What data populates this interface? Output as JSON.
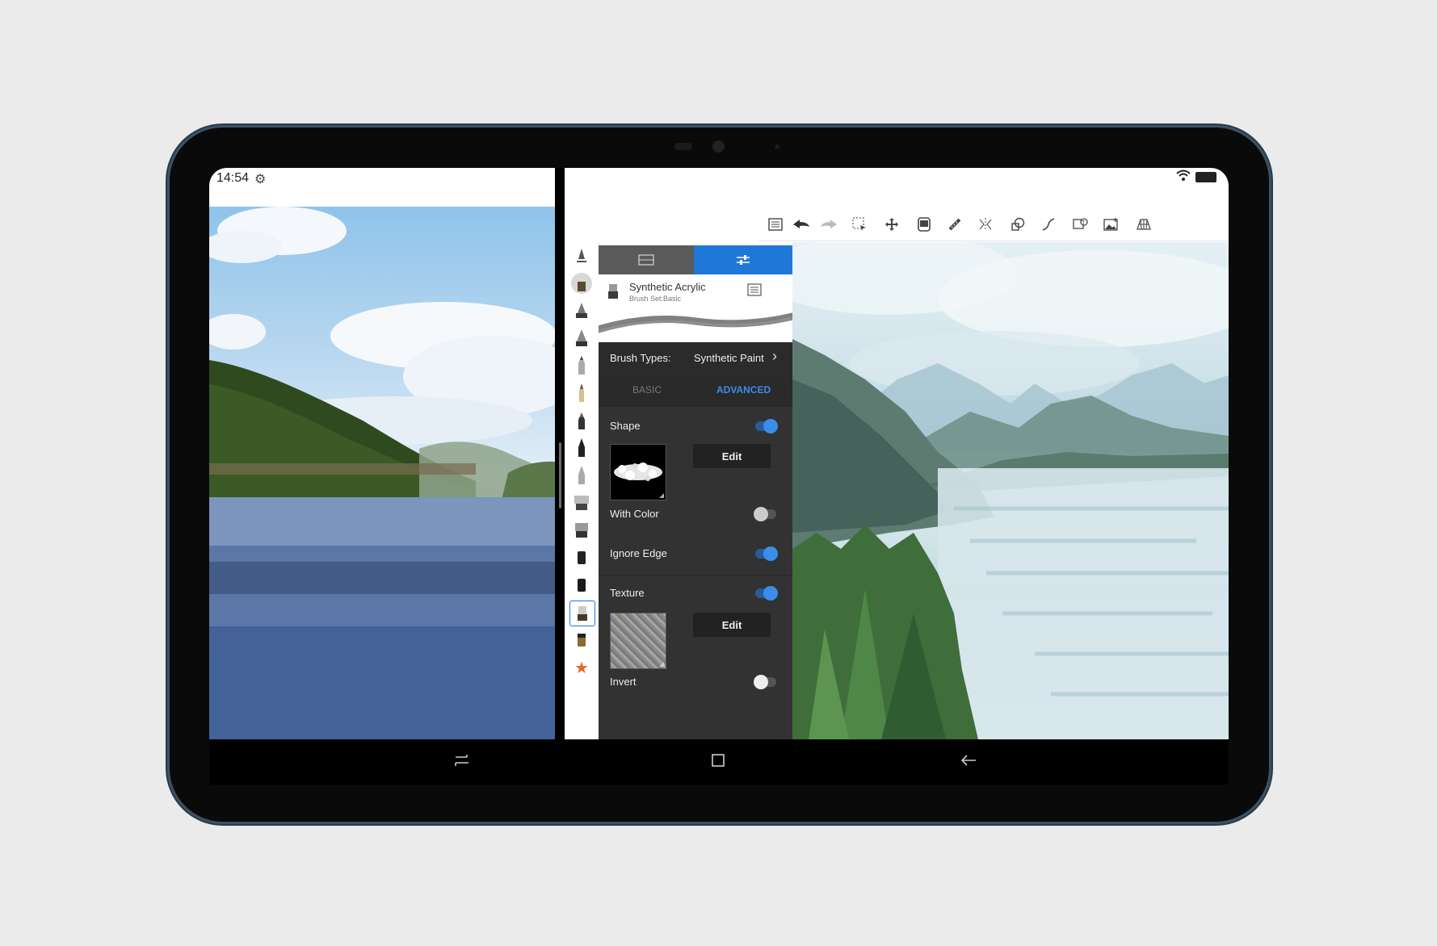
{
  "status_bar": {
    "time": "14:54",
    "settings_icon": "gear-icon",
    "wifi_icon": "wifi-icon",
    "battery_icon": "battery-icon"
  },
  "toolbar": {
    "icons": [
      "list-icon",
      "undo-icon",
      "redo-icon",
      "selection-icon",
      "move-icon",
      "layers-icon",
      "ruler-icon",
      "symmetry-icon",
      "shapes-icon",
      "stroke-icon",
      "text-icon",
      "image-icon",
      "perspective-icon"
    ]
  },
  "brush_panel": {
    "brush_name": "Synthetic Acrylic",
    "brush_set": "Brush Set:Basic",
    "brush_types_label": "Brush Types:",
    "brush_types_value": "Synthetic Paint",
    "tab_basic": "BASIC",
    "tab_advanced": "ADVANCED",
    "shape_label": "Shape",
    "shape_on": true,
    "edit_label": "Edit",
    "with_color_label": "With Color",
    "with_color_on": false,
    "ignore_edge_label": "Ignore Edge",
    "ignore_edge_on": true,
    "texture_label": "Texture",
    "texture_on": true,
    "invert_label": "Invert",
    "invert_on": false,
    "accent_color": "#1f77d8"
  },
  "nav_bar": {
    "icons": [
      "recents-icon",
      "home-icon",
      "back-icon"
    ]
  }
}
